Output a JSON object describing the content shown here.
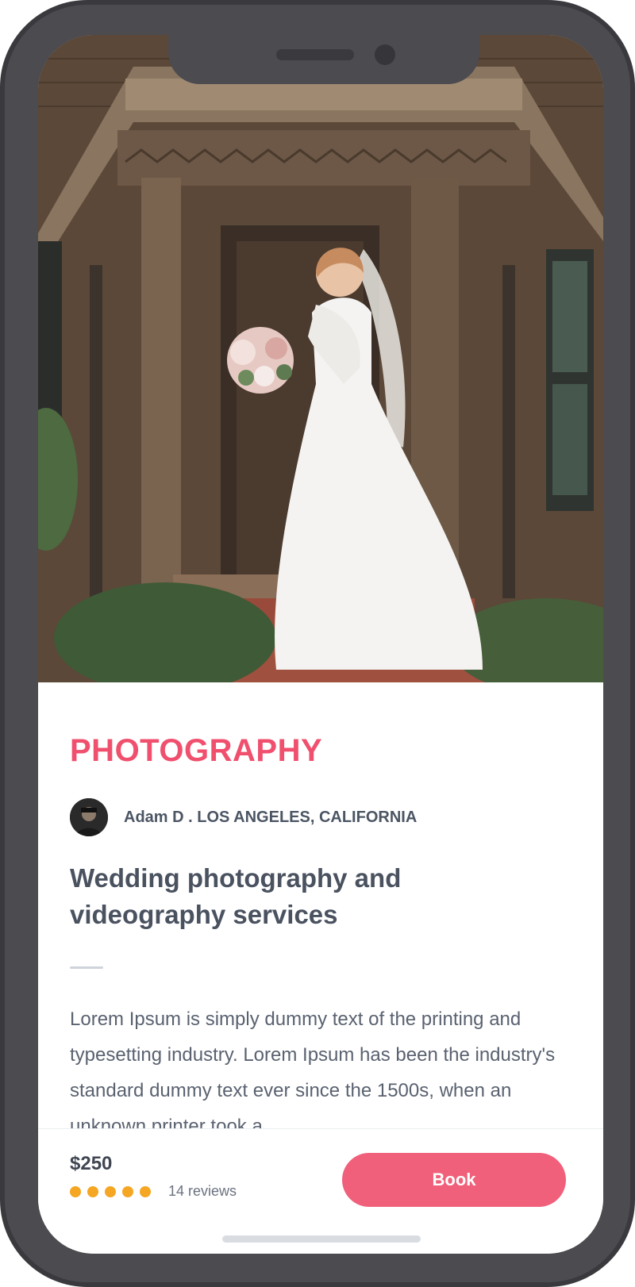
{
  "hero": {
    "image_icon": "wedding-photo-bride-on-porch"
  },
  "listing": {
    "category": "PHOTOGRAPHY",
    "author_line": "Adam D . LOS ANGELES, CALIFORNIA",
    "title": "Wedding photography and videography services",
    "description": "Lorem Ipsum is simply dummy text of the printing and typesetting industry. Lorem Ipsum has been the industry's standard dummy text ever since the 1500s, when an unknown printer took a"
  },
  "footer": {
    "price": "$250",
    "rating": 5,
    "rating_max": 5,
    "reviews_label": "14 reviews",
    "book_label": "Book"
  },
  "colors": {
    "accent": "#f0506e",
    "button": "#f0607a",
    "star": "#f5a623",
    "frame": "#4b4b50"
  }
}
